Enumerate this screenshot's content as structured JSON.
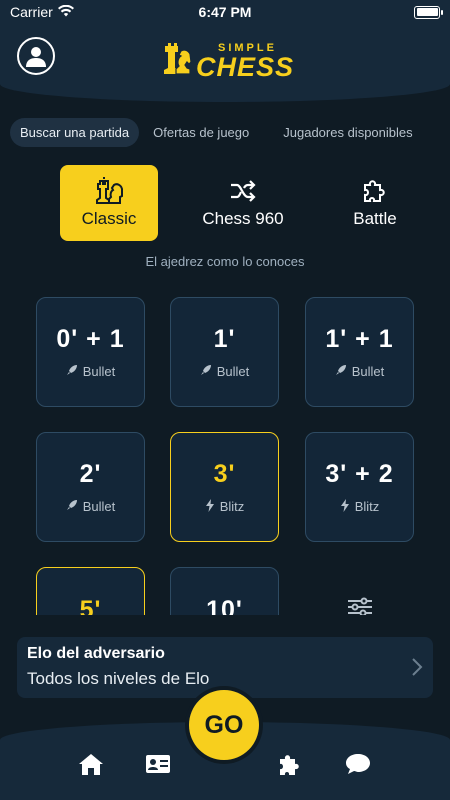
{
  "status_bar": {
    "carrier": "Carrier",
    "time": "6:47 PM"
  },
  "header": {
    "logo_small": "SIMPLE",
    "logo_big": "CHESS",
    "avatar_icon": "user-circle-icon"
  },
  "tabs": [
    {
      "label": "Buscar una partida",
      "active": true
    },
    {
      "label": "Ofertas de juego",
      "active": false
    },
    {
      "label": "Jugadores disponibles",
      "active": false
    }
  ],
  "modes": [
    {
      "label": "Classic",
      "icon": "chess-pieces-icon",
      "active": true
    },
    {
      "label": "Chess 960",
      "icon": "shuffle-icon",
      "active": false
    },
    {
      "label": "Battle",
      "icon": "puzzle-icon",
      "active": false
    }
  ],
  "mode_description": "El ajedrez como lo conoces",
  "time_controls": [
    {
      "time": "0' + 1",
      "type": "Bullet",
      "icon": "rocket-icon",
      "selected": false
    },
    {
      "time": "1'",
      "type": "Bullet",
      "icon": "rocket-icon",
      "selected": false
    },
    {
      "time": "1' + 1",
      "type": "Bullet",
      "icon": "rocket-icon",
      "selected": false
    },
    {
      "time": "2'",
      "type": "Bullet",
      "icon": "rocket-icon",
      "selected": false
    },
    {
      "time": "3'",
      "type": "Blitz",
      "icon": "lightning-icon",
      "selected": true
    },
    {
      "time": "3' + 2",
      "type": "Blitz",
      "icon": "lightning-icon",
      "selected": false
    },
    {
      "time": "5'",
      "type": "",
      "icon": "",
      "selected": true
    },
    {
      "time": "10'",
      "type": "",
      "icon": "",
      "selected": false
    }
  ],
  "elo": {
    "title": "Elo del adversario",
    "value": "Todos los niveles de Elo"
  },
  "go_label": "GO",
  "bottom_nav": [
    "home-icon",
    "id-card-icon",
    "puzzle-icon",
    "chat-bubble-icon"
  ],
  "colors": {
    "accent": "#f7cf1d",
    "background": "#0f1b24",
    "panel": "#16293a",
    "tile_border": "#2e4b63"
  }
}
